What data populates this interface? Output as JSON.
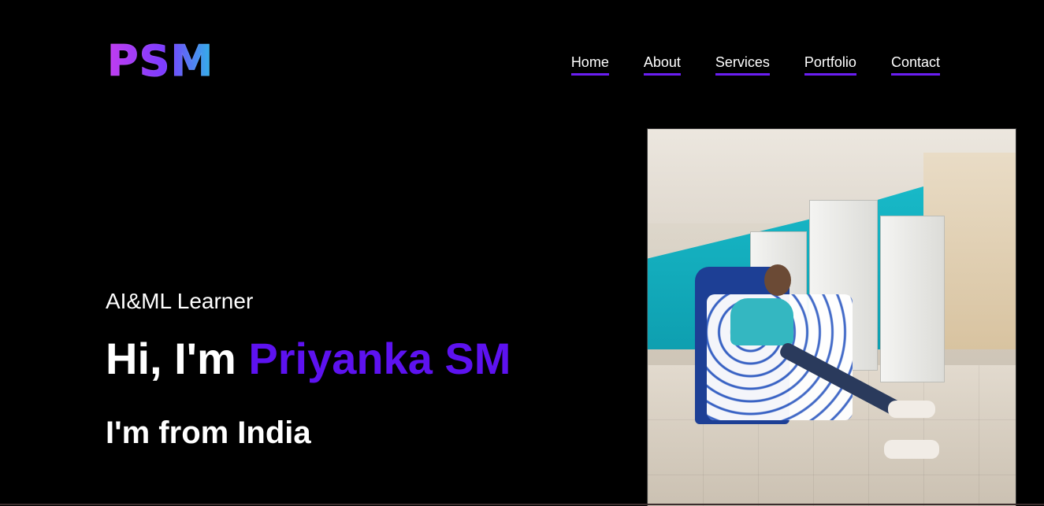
{
  "logo": {
    "text": "PSM"
  },
  "nav": {
    "items": [
      {
        "label": "Home"
      },
      {
        "label": "About"
      },
      {
        "label": "Services"
      },
      {
        "label": "Portfolio"
      },
      {
        "label": "Contact"
      }
    ],
    "underline_color": "#6a1ef2"
  },
  "hero": {
    "subtitle": "AI&ML Learner",
    "greeting": "Hi, I'm",
    "name": "Priyanka SM",
    "location": "I'm from India",
    "accent_color": "#5d12f0"
  }
}
